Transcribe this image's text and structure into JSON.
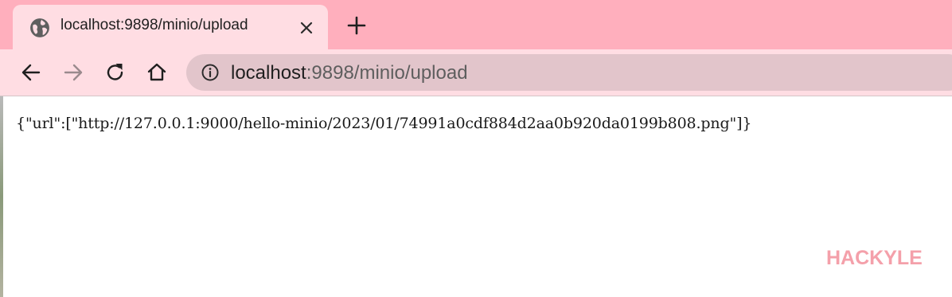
{
  "tab": {
    "title": "localhost:9898/minio/upload",
    "favicon": "globe-icon",
    "close_icon": "close-icon"
  },
  "new_tab": {
    "icon": "plus-icon"
  },
  "toolbar": {
    "back_icon": "back-arrow-icon",
    "forward_icon": "forward-arrow-icon",
    "reload_icon": "reload-icon",
    "home_icon": "home-icon"
  },
  "address_bar": {
    "info_icon": "info-icon",
    "host": "localhost",
    "path": ":9898/minio/upload"
  },
  "page": {
    "body_text": "{\"url\":[\"http://127.0.0.1:9000/hello-minio/2023/01/74991a0cdf884d2aa0b920da0199b808.png\"]}"
  },
  "watermark": {
    "text": "HACKYLE"
  },
  "colors": {
    "tabstrip": "#ffafbd",
    "active_tab": "#ffdde3",
    "omnibox": "#e2c5cb",
    "watermark": "#f4a0aa"
  }
}
